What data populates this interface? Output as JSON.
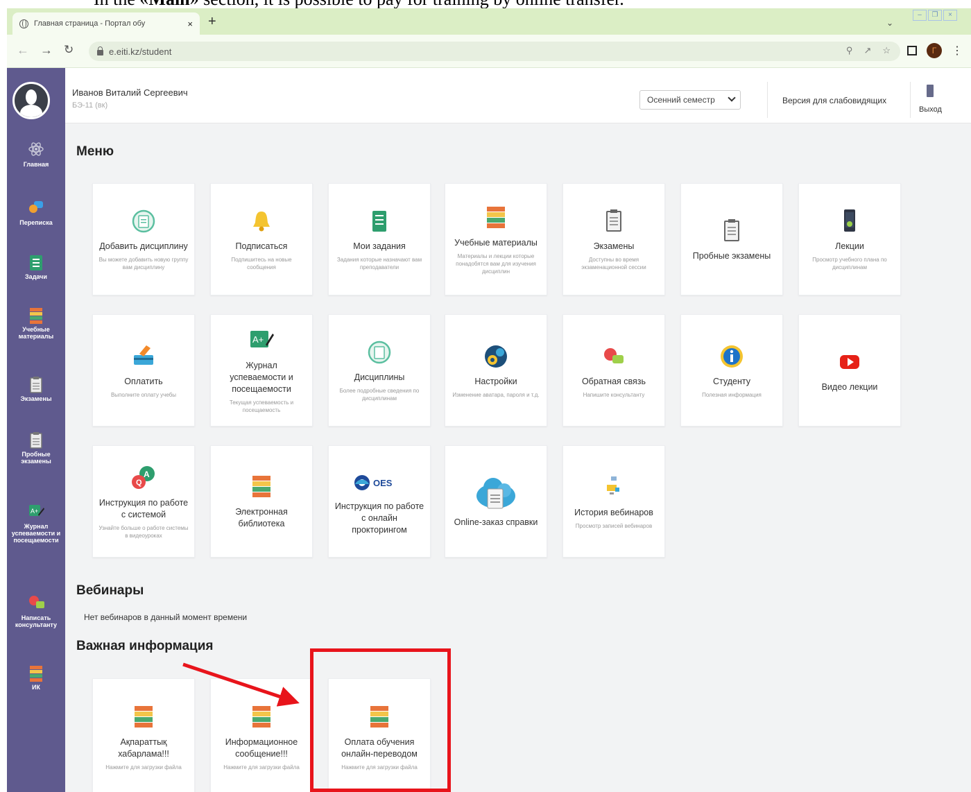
{
  "document": {
    "caption_prefix": "In the «",
    "caption_bold": "Main",
    "caption_suffix": "» section, it is possible to pay for training by online transfer."
  },
  "browser": {
    "tab_title": "Главная страница - Портал обу",
    "tab_close": "×",
    "new_tab": "+",
    "url": "e.eiti.kz/student"
  },
  "user": {
    "name": "Иванов Виталий Сергеевич",
    "group": "БЭ-11 (вк)"
  },
  "header": {
    "semester": "Осенний семестр",
    "low_vision": "Версия для слабовидящих",
    "exit": "Выход"
  },
  "sidebar": {
    "items": [
      {
        "label": "Главная",
        "icon": "atom-icon"
      },
      {
        "label": "Переписка",
        "icon": "chat-icon"
      },
      {
        "label": "Задачи",
        "icon": "tasks-icon"
      },
      {
        "label": "Учебные материалы",
        "icon": "books-icon"
      },
      {
        "label": "Экзамены",
        "icon": "clipboard-icon"
      },
      {
        "label": "Пробные экзамены",
        "icon": "clipboard-icon"
      },
      {
        "label": "Журнал успеваемости и посещаемости",
        "icon": "grade-icon"
      },
      {
        "label": "Написать консультанту",
        "icon": "feedback-icon"
      },
      {
        "label": "ИК",
        "icon": "books-icon"
      }
    ]
  },
  "sections": {
    "menu": "Меню",
    "webinars": "Вебинары",
    "no_webinars": "Нет вебинаров в данный момент времени",
    "important": "Важная информация"
  },
  "menu_cards": [
    {
      "title": "Добавить дисциплину",
      "desc": "Вы можете добавить новую группу вам дисциплину",
      "icon": "add-discipline-icon"
    },
    {
      "title": "Подписаться",
      "desc": "Подпишитесь на новые сообщения",
      "icon": "bell-icon"
    },
    {
      "title": "Мои задания",
      "desc": "Задания которые назначают вам преподаватели",
      "icon": "tasks-icon"
    },
    {
      "title": "Учебные материалы",
      "desc": "Материалы и лекции которые понадобятся вам для изучения дисциплин",
      "icon": "books-icon"
    },
    {
      "title": "Экзамены",
      "desc": "Доступны во время экзаменационной сессии",
      "icon": "clipboard-icon"
    },
    {
      "title": "Пробные экзамены",
      "desc": "",
      "icon": "clipboard-icon"
    },
    {
      "title": "Лекции",
      "desc": "Просмотр учебного плана по дисциплинам",
      "icon": "phone-icon"
    },
    {
      "title": "Оплатить",
      "desc": "Выполните оплату учебы",
      "icon": "pay-icon"
    },
    {
      "title": "Журнал успеваемости и посещаемости",
      "desc": "Текущая успеваемость и посещаемость",
      "icon": "grade-icon"
    },
    {
      "title": "Дисциплины",
      "desc": "Более подробные сведения по дисциплинам",
      "icon": "discipline-icon"
    },
    {
      "title": "Настройки",
      "desc": "Изменение аватара, пароля и т.д.",
      "icon": "settings-icon"
    },
    {
      "title": "Обратная связь",
      "desc": "Напишите консультанту",
      "icon": "feedback-icon"
    },
    {
      "title": "Студенту",
      "desc": "Полезная информация",
      "icon": "info-icon"
    },
    {
      "title": "Видео лекции",
      "desc": "",
      "icon": "youtube-icon"
    },
    {
      "title": "Инструкция по работе с системой",
      "desc": "Узнайте больше о работе системы в видеоуроках",
      "icon": "instruction-icon"
    },
    {
      "title": "Электронная библиотека",
      "desc": "",
      "icon": "books-icon"
    },
    {
      "title": "Инструкция по работе с онлайн прокторингом",
      "desc": "",
      "icon": "oes-icon",
      "logo_text": "OES"
    },
    {
      "title": "Online-заказ справки",
      "desc": "",
      "icon": "cloud-doc-icon"
    },
    {
      "title": "История вебинаров",
      "desc": "Просмотр записей вебинаров",
      "icon": "webinar-history-icon"
    }
  ],
  "important_cards": [
    {
      "title": "Ақпараттық хабарлама!!!",
      "desc": "Нажмите для загрузки файла",
      "icon": "books-icon"
    },
    {
      "title": "Информационное сообщение!!!",
      "desc": "Нажмите для загрузки файла",
      "icon": "books-icon"
    },
    {
      "title": "Оплата обучения онлайн-переводом",
      "desc": "Нажмите для загрузки файла",
      "icon": "books-icon"
    }
  ],
  "colors": {
    "sidebar": "#5f5a8e",
    "highlight": "#e8141b",
    "tabbar": "#dbeec5"
  }
}
